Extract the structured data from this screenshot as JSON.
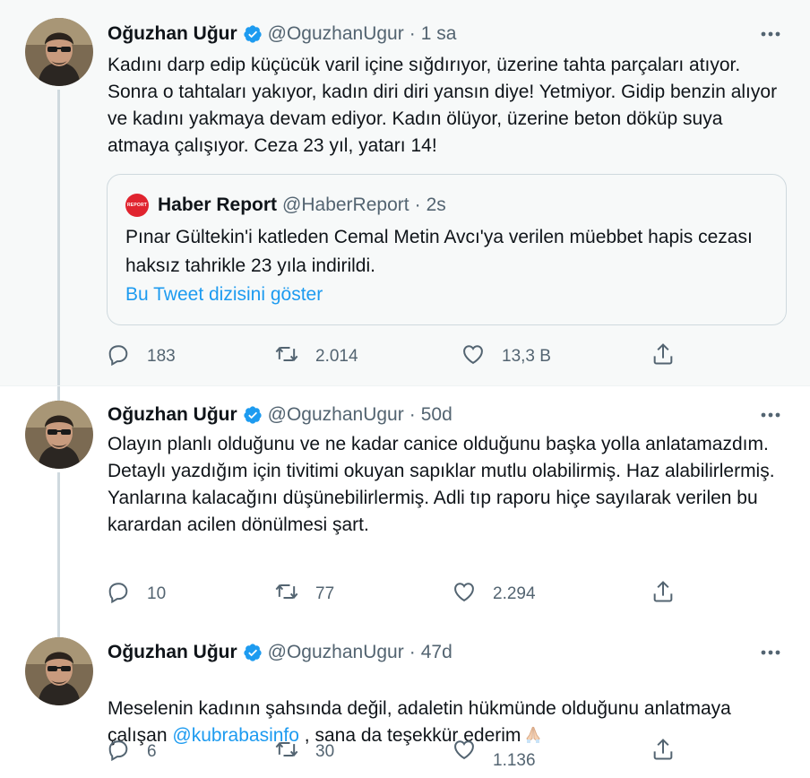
{
  "colors": {
    "accent": "#1d9bf0",
    "muted": "#536471",
    "text": "#0f1419",
    "highlight_bg": "#f7f9f9"
  },
  "tweets": [
    {
      "name": "Oğuzhan Uğur",
      "handle": "@OguzhanUgur",
      "dot": "·",
      "time": "1 sa",
      "text": "Kadını darp edip küçücük varil içine sığdırıyor, üzerine tahta parçaları atıyor. Sonra o tahtaları yakıyor, kadın diri diri yansın diye! Yetmiyor. Gidip benzin alıyor ve kadını yakmaya devam ediyor. Kadın ölüyor, üzerine beton döküp suya atmaya çalışıyor. Ceza 23 yıl, yatarı 14!",
      "quote": {
        "logo_text": "REPORT",
        "name": "Haber Report",
        "handle": "@HaberReport",
        "dot": "·",
        "time": "2s",
        "text": "Pınar Gültekin'i katleden Cemal Metin Avcı'ya verilen müebbet hapis cezası haksız tahrikle 23 yıla indirildi.",
        "link": "Bu Tweet dizisini göster"
      },
      "replies": "183",
      "retweets": "2.014",
      "likes": "13,3 B"
    },
    {
      "name": "Oğuzhan Uğur",
      "handle": "@OguzhanUgur",
      "dot": "·",
      "time": "50d",
      "text": "Olayın planlı olduğunu ve ne kadar canice olduğunu başka yolla anlatamazdım.\nDetaylı yazdığım için tivitimi okuyan sapıklar mutlu olabilirmiş. Haz alabilirlermiş. Yanlarına kalacağını düşünebilirlermiş. Adli tıp raporu hiçe sayılarak verilen bu karardan acilen dönülmesi şart.",
      "replies": "10",
      "retweets": "77",
      "likes": "2.294"
    },
    {
      "name": "Oğuzhan Uğur",
      "handle": "@OguzhanUgur",
      "dot": "·",
      "time": "47d",
      "text_before": "Meselenin kadının şahsında değil, adaletin hükmünde olduğunu anlatmaya çalışan ",
      "mention": "@kubrabasinfo",
      "text_after": " , sana da teşekkür ederim",
      "emoji_name": "folded-hands",
      "replies": "6",
      "retweets": "30",
      "likes": "1.136"
    }
  ]
}
